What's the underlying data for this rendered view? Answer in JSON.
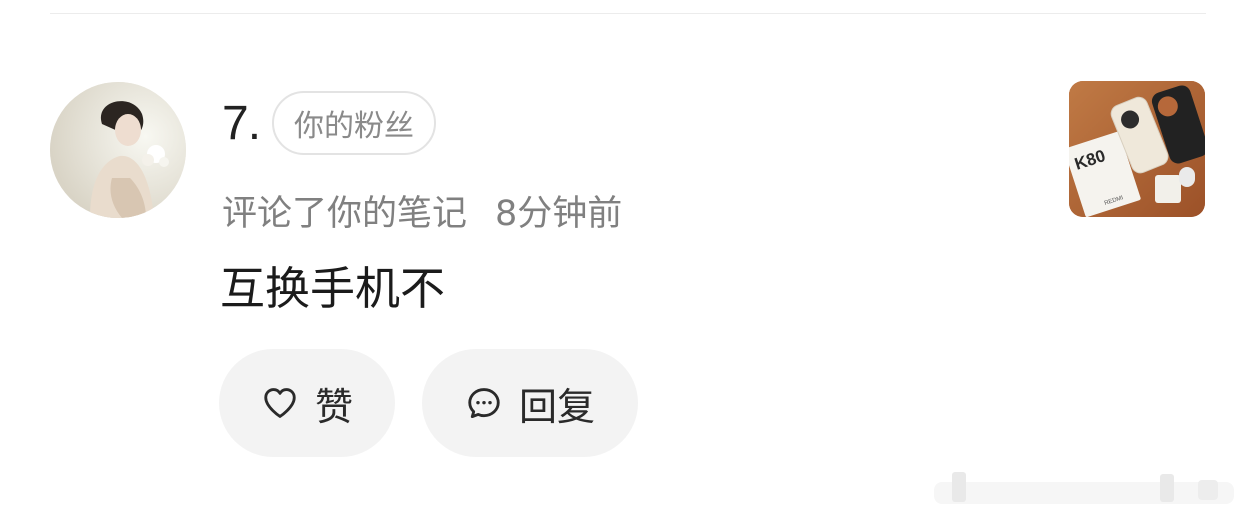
{
  "notification": {
    "rank": "7.",
    "badge": "你的粉丝",
    "action": "评论了你的笔记",
    "time": "8分钟前",
    "comment": "互换手机不"
  },
  "actions": {
    "like_label": "赞",
    "reply_label": "回复"
  },
  "thumbnail": {
    "box_text": "K80",
    "brand_text": "REDMI"
  },
  "icons": {
    "like": "heart-outline-icon",
    "reply": "chat-bubble-dots-icon"
  },
  "colors": {
    "button_bg": "#f3f3f3",
    "secondary_text": "#808080",
    "badge_border": "#e3e3e3"
  }
}
